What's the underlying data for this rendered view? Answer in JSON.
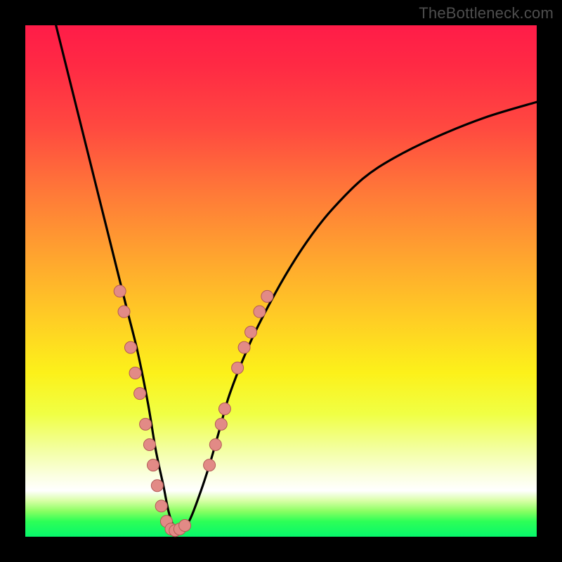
{
  "attribution": "TheBottleneck.com",
  "colors": {
    "gradient_top": "#ff1c48",
    "gradient_mid": "#ffcf24",
    "gradient_bottom": "#07f76b",
    "curve": "#000000",
    "marker_fill": "#e28a86",
    "marker_stroke": "#b25a56",
    "frame": "#000000"
  },
  "chart_data": {
    "type": "line",
    "title": "",
    "xlabel": "",
    "ylabel": "",
    "xlim": [
      0,
      100
    ],
    "ylim": [
      0,
      100
    ],
    "grid": false,
    "legend": false,
    "series": [
      {
        "name": "bottleneck-curve",
        "x": [
          6,
          8,
          10,
          12,
          14,
          16,
          18,
          20,
          22,
          24,
          25.5,
          27,
          28,
          29,
          30,
          32,
          34,
          36,
          38,
          40,
          44,
          48,
          52,
          56,
          60,
          66,
          72,
          80,
          90,
          100
        ],
        "y": [
          100,
          92,
          84,
          76,
          68,
          60,
          52,
          44,
          36,
          26,
          17,
          10,
          5,
          2,
          1,
          3,
          8,
          14,
          21,
          28,
          38,
          46,
          53,
          59,
          64,
          70,
          74,
          78,
          82,
          85
        ]
      }
    ],
    "markers_left": [
      {
        "x": 18.5,
        "y": 48
      },
      {
        "x": 19.3,
        "y": 44
      },
      {
        "x": 20.6,
        "y": 37
      },
      {
        "x": 21.5,
        "y": 32
      },
      {
        "x": 22.4,
        "y": 28
      },
      {
        "x": 23.5,
        "y": 22
      },
      {
        "x": 24.3,
        "y": 18
      },
      {
        "x": 25.0,
        "y": 14
      },
      {
        "x": 25.8,
        "y": 10
      },
      {
        "x": 26.6,
        "y": 6
      },
      {
        "x": 27.6,
        "y": 3
      }
    ],
    "markers_bottom": [
      {
        "x": 28.5,
        "y": 1.5
      },
      {
        "x": 29.3,
        "y": 1.2
      },
      {
        "x": 30.2,
        "y": 1.5
      },
      {
        "x": 31.2,
        "y": 2.2
      }
    ],
    "markers_right": [
      {
        "x": 36.0,
        "y": 14
      },
      {
        "x": 37.2,
        "y": 18
      },
      {
        "x": 38.3,
        "y": 22
      },
      {
        "x": 39.0,
        "y": 25
      },
      {
        "x": 41.5,
        "y": 33
      },
      {
        "x": 42.8,
        "y": 37
      },
      {
        "x": 44.1,
        "y": 40
      },
      {
        "x": 45.8,
        "y": 44
      },
      {
        "x": 47.3,
        "y": 47
      }
    ]
  }
}
